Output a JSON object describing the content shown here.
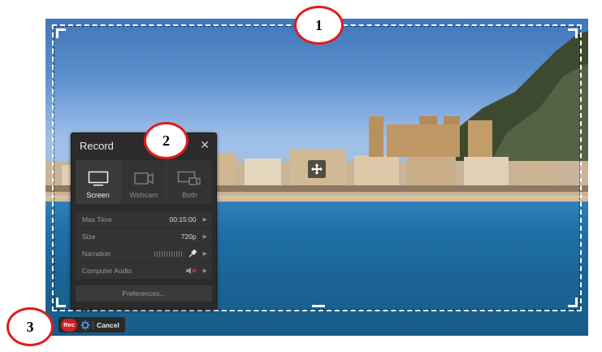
{
  "callouts": [
    "1",
    "2",
    "3"
  ],
  "record_panel": {
    "title": "Record",
    "close_icon": "close-icon",
    "modes": [
      {
        "label": "Screen",
        "icon": "monitor-icon",
        "selected": true
      },
      {
        "label": "Webcam",
        "icon": "webcam-icon",
        "selected": false
      },
      {
        "label": "Both",
        "icon": "screen-and-webcam-icon",
        "selected": false
      }
    ],
    "settings": [
      {
        "label": "Max Time",
        "value": "00:15:00"
      },
      {
        "label": "Size",
        "value": "720p"
      },
      {
        "label": "Narration",
        "value": "",
        "icon": "microphone-icon"
      },
      {
        "label": "Computer Audio",
        "value": "",
        "icon": "speaker-muted-icon"
      }
    ],
    "preferences_label": "Preferences..."
  },
  "toolbar": {
    "rec_label": "Rec",
    "settings_icon": "gear-icon",
    "cancel_label": "Cancel"
  },
  "colors": {
    "accent_red": "#d41f1f",
    "callout_border": "#e21b1b",
    "panel_bg": "#2b2b2b"
  }
}
